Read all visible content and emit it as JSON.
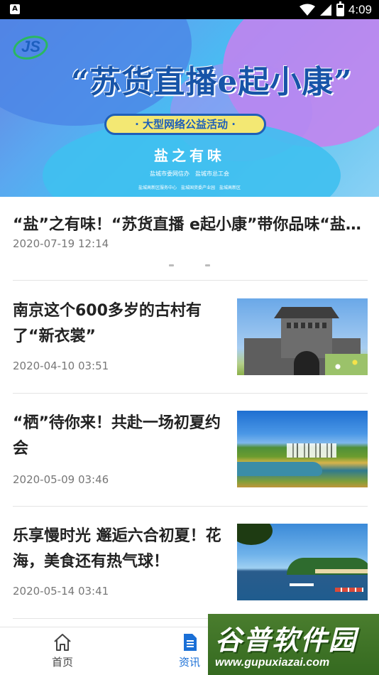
{
  "status_bar": {
    "notification": "A",
    "time": "4:09"
  },
  "banner": {
    "logo_text": "JS",
    "title": "“苏货直播e起小康”",
    "pill": "· 大型网络公益活动 ·",
    "subtitle": "盐之有味",
    "org_line1": "盐城市委网信办　盐城市总工会",
    "org_line2": "盐城高新区服务中心　盐城国资委产业园　盐城高新区"
  },
  "featured": {
    "title": "“盐”之有味！“苏货直播 e起小康”带你品味“盐…",
    "time": "2020-07-19 12:14"
  },
  "news": [
    {
      "title": "南京这个600多岁的古村有了“新衣裳”",
      "time": "2020-04-10 03:51"
    },
    {
      "title": "“栖”待你来！共赴一场初夏约会",
      "time": "2020-05-09 03:46"
    },
    {
      "title": "乐享慢时光 邂逅六合初夏！花海，美食还有热气球！",
      "time": "2020-05-14 03:41"
    }
  ],
  "tab_bar": {
    "home_label": "首页",
    "news_label": "资讯",
    "active_color": "#1a6fd6"
  },
  "watermark": {
    "title": "谷普软件园",
    "url": "www.gupuxiazai.com"
  }
}
